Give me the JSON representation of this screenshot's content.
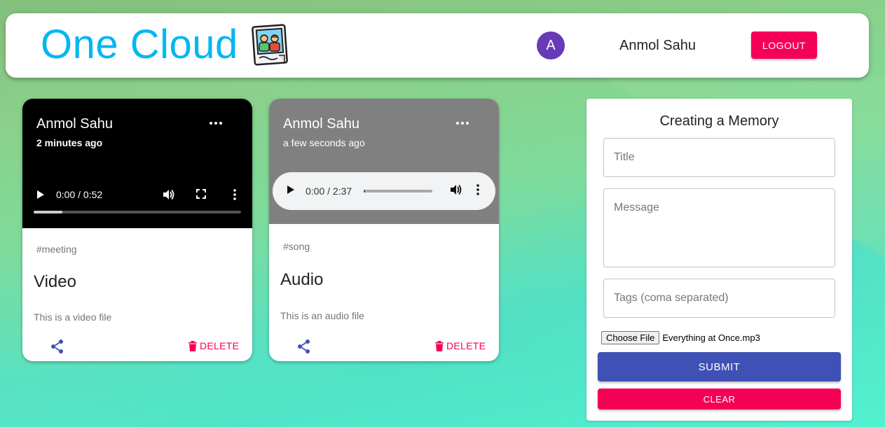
{
  "header": {
    "brand": "One Cloud",
    "avatar_initial": "A",
    "user_name": "Anmol Sahu",
    "logout_label": "LOGOUT"
  },
  "posts": [
    {
      "author": "Anmol Sahu",
      "time": "2 minutes ago",
      "media": "video",
      "player_time": "0:00 / 0:52",
      "tags": "#meeting",
      "title": "Video",
      "message": "This is a video file",
      "delete_label": "DELETE"
    },
    {
      "author": "Anmol Sahu",
      "time": "a few seconds ago",
      "media": "audio",
      "player_time": "0:00 / 2:37",
      "tags": "#song",
      "title": "Audio",
      "message": "This is an audio file",
      "delete_label": "DELETE"
    }
  ],
  "form": {
    "heading": "Creating a Memory",
    "title_placeholder": "Title",
    "message_placeholder": "Message",
    "tags_placeholder": "Tags (coma separated)",
    "file_button": "Choose File",
    "file_name": "Everything at Once.mp3",
    "submit_label": "SUBMIT",
    "clear_label": "CLEAR"
  },
  "colors": {
    "brand": "#00b7f1",
    "avatar": "#673ab7",
    "secondary": "#f50057",
    "primary": "#3f51b5"
  }
}
